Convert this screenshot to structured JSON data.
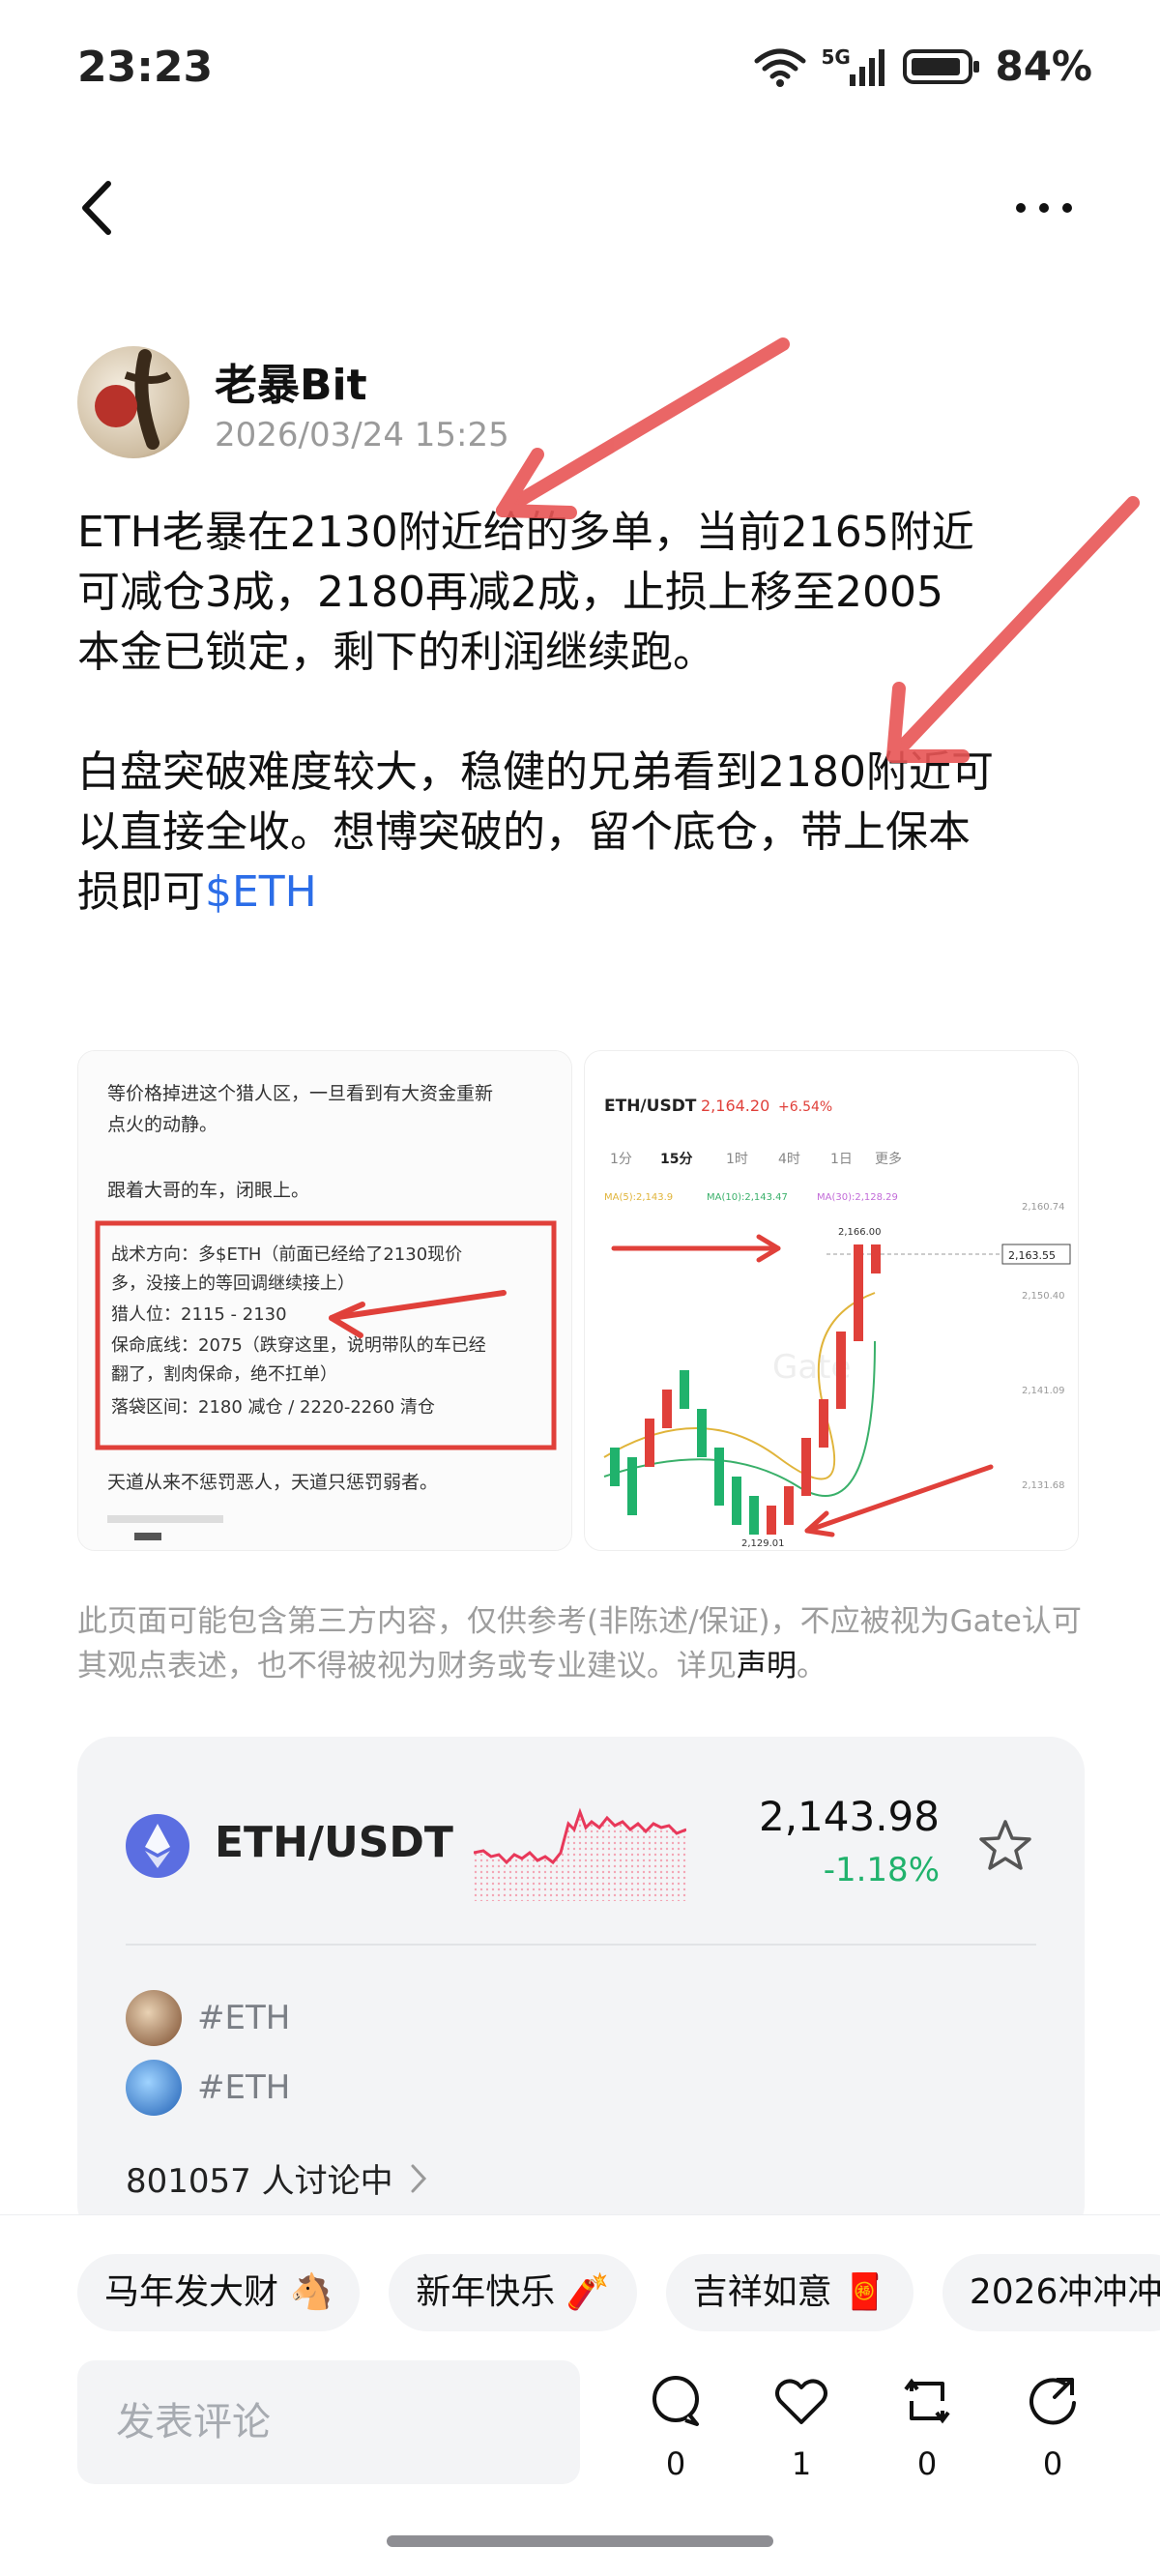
{
  "status_bar": {
    "time": "23:23",
    "network": "5G",
    "battery_pct": "84%"
  },
  "nav": {
    "back_icon": "chevron-left-icon",
    "more_icon": "more-horizontal-icon"
  },
  "post": {
    "author": "老暴Bit",
    "timestamp": "2026/03/24 15:25",
    "para1_lines": [
      "ETH老暴在2130附近给的多单，当前2165附近",
      "可减仓3成，2180再减2成，止损上移至2005",
      "本金已锁定，剩下的利润继续跑。"
    ],
    "para2_lines": [
      "白盘突破难度较大，稳健的兄弟看到2180附近可",
      "以直接全收。想博突破的，留个底仓，带上保本"
    ],
    "para2_last_prefix": "损即可",
    "ticker_link": "$ETH"
  },
  "images": {
    "left": {
      "line1": "等价格掉进这个猎人区，一旦看到有大资金重新",
      "line2": "点火的动静。",
      "line3": "跟着大哥的车，闭眼上。",
      "box_lines": [
        "战术方向：多$ETH（前面已经给了2130现价",
        "多，没接上的等回调继续接上）",
        "猎人位：2115 - 2130",
        "保命底线：2075（跌穿这里，说明带队的车已经",
        "翻了，割肉保命，绝不扛单）",
        "落袋区间：2180 减仓 / 2220-2260 清仓"
      ],
      "line4": "天道从来不惩罚恶人，天道只惩罚弱者。"
    },
    "right": {
      "pair": "ETH/USDT",
      "price": "2,164.20",
      "change": "+6.54%",
      "tabs": [
        "1分",
        "15分",
        "1时",
        "4时",
        "1日",
        "更多"
      ],
      "ma_labels": [
        "MA(5):2,143.9",
        "MA(10):2,143.47",
        "MA(30):2,128.29"
      ],
      "high_label": "2,166.00",
      "low_label": "2,129.01",
      "last_label": "2,163.55",
      "axis_labels": [
        "2,160.74",
        "2,150.40",
        "2,141.09",
        "2,131.68"
      ],
      "watermark": "Gate"
    }
  },
  "disclaimer": {
    "text": "此页面可能包含第三方内容，仅供参考(非陈述/保证)，不应被视为Gate认可其观点表述，也不得被视为财务或专业建议。详见",
    "link": "声明",
    "end": "。"
  },
  "market": {
    "pair": "ETH/USDT",
    "price": "2,143.98",
    "change": "-1.18%",
    "colors": {
      "up": "#20b26c",
      "spark": "#e8385a"
    },
    "tags": [
      "#ETH",
      "#ETH"
    ],
    "discussing": "801057 人讨论中"
  },
  "bottom": {
    "chips": [
      "马年发大财 🐴",
      "新年快乐 🧨",
      "吉祥如意 🧧",
      "2026冲冲冲"
    ],
    "comment_placeholder": "发表评论",
    "actions": [
      {
        "icon": "comment-icon",
        "count": "0"
      },
      {
        "icon": "heart-icon",
        "count": "1"
      },
      {
        "icon": "repost-icon",
        "count": "0"
      },
      {
        "icon": "share-icon",
        "count": "0"
      }
    ]
  }
}
